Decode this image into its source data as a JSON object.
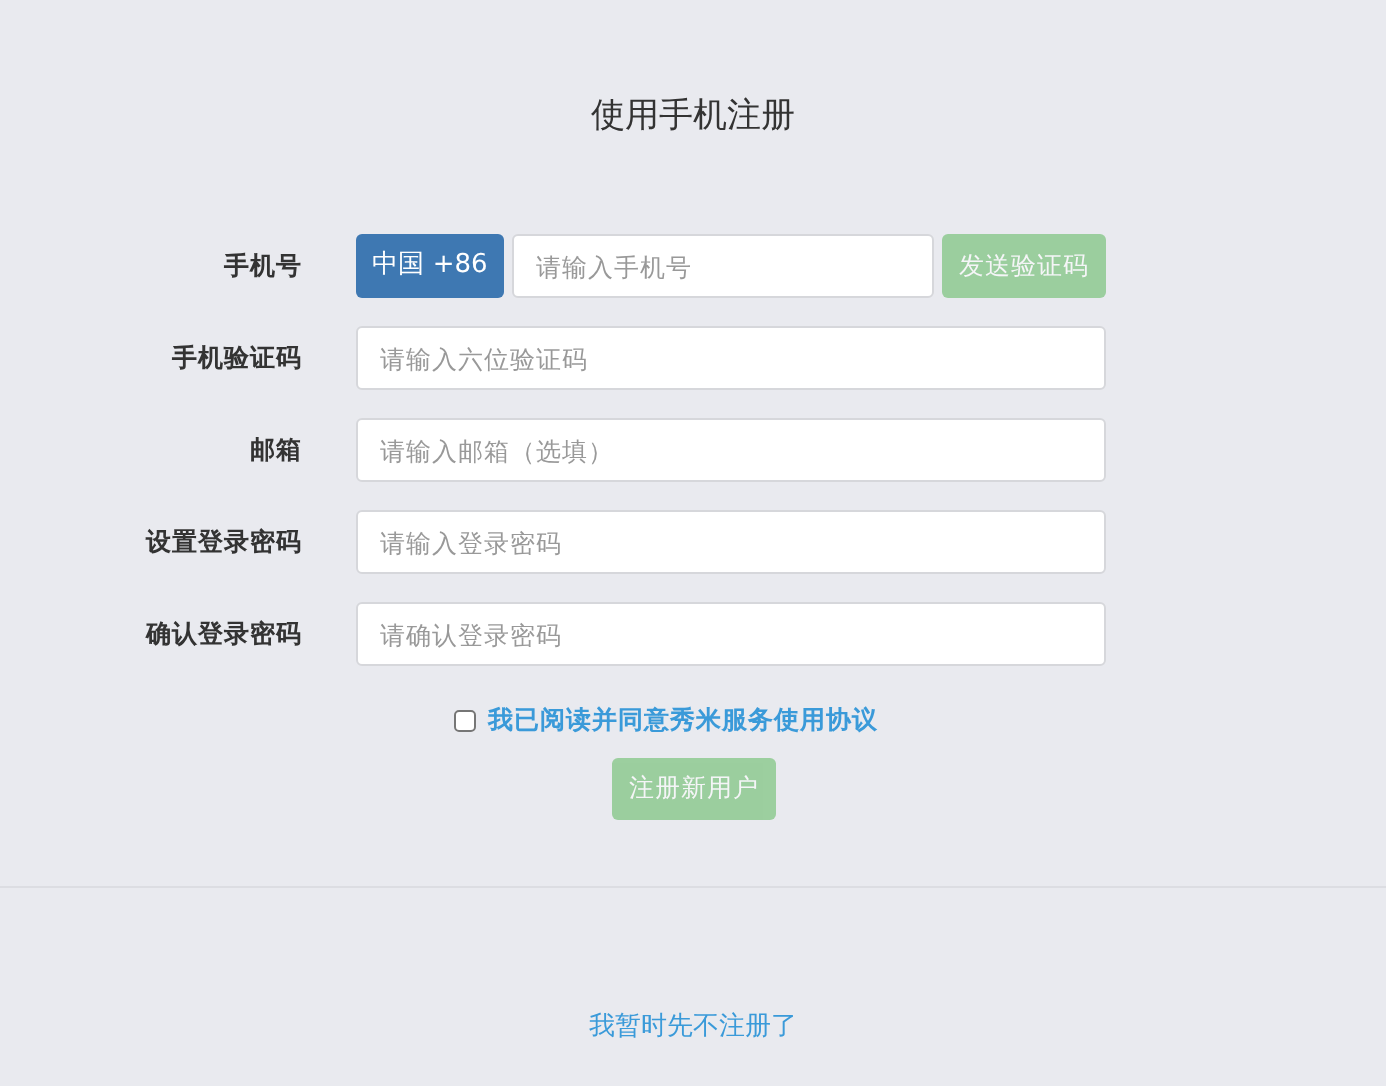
{
  "title": "使用手机注册",
  "fields": [
    {
      "label": "手机号",
      "kind": "phone",
      "country_code": "中国 +86",
      "placeholder": "请输入手机号",
      "send_button": {
        "label": "发送验证码",
        "disabled": true
      }
    },
    {
      "label": "手机验证码",
      "kind": "text",
      "placeholder": "请输入六位验证码"
    },
    {
      "label": "邮箱",
      "kind": "text",
      "placeholder": "请输入邮箱（选填）"
    },
    {
      "label": "设置登录密码",
      "kind": "text",
      "placeholder": "请输入登录密码"
    },
    {
      "label": "确认登录密码",
      "kind": "text",
      "placeholder": "请确认登录密码"
    }
  ],
  "agreement": {
    "label": "我已阅读并同意秀米服务使用协议",
    "checked": false
  },
  "register_button": {
    "label": "注册新用户",
    "disabled": true
  },
  "skip_link": "我暂时先不注册了"
}
